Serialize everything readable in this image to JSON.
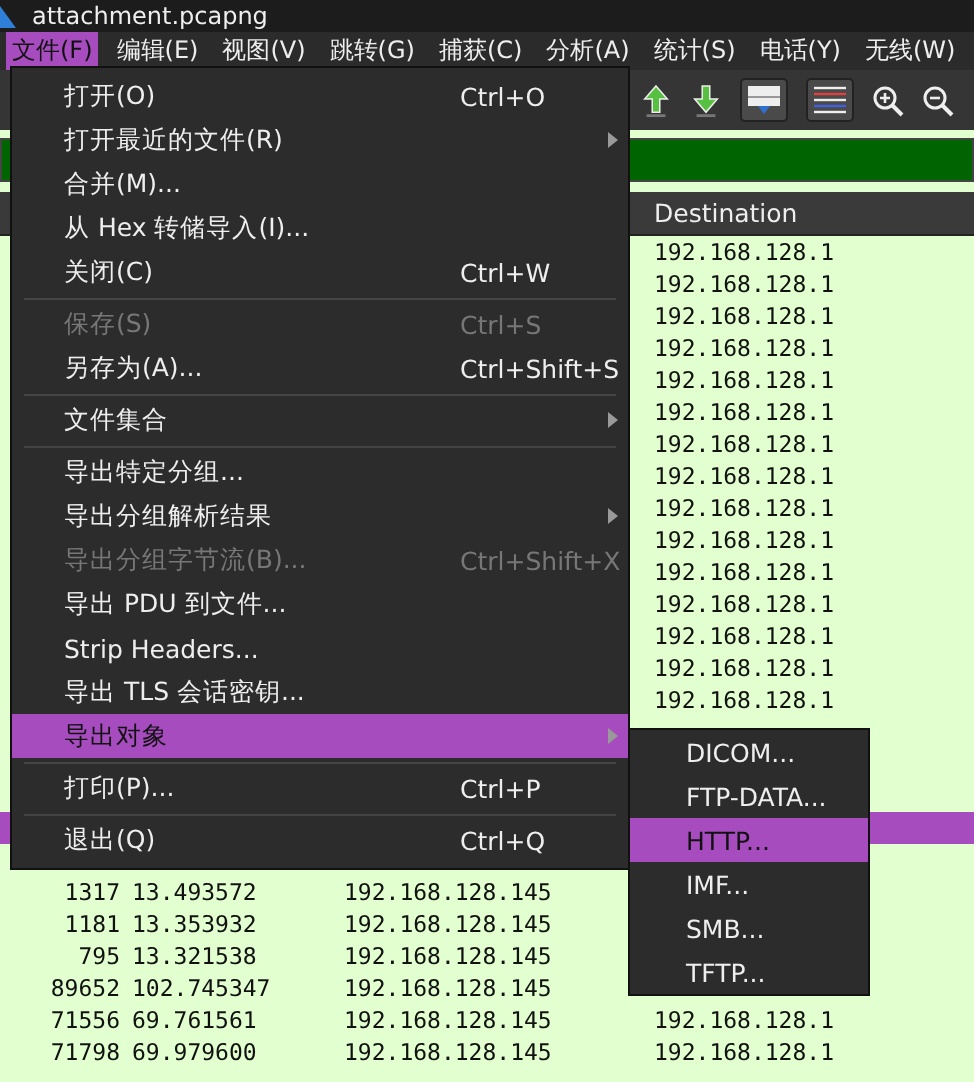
{
  "window": {
    "title": "attachment.pcapng"
  },
  "menubar": [
    {
      "label": "文件(F)",
      "selected": true
    },
    {
      "label": "编辑(E)",
      "selected": false
    },
    {
      "label": "视图(V)",
      "selected": false
    },
    {
      "label": "跳转(G)",
      "selected": false
    },
    {
      "label": "捕获(C)",
      "selected": false
    },
    {
      "label": "分析(A)",
      "selected": false
    },
    {
      "label": "统计(S)",
      "selected": false
    },
    {
      "label": "电话(Y)",
      "selected": false
    },
    {
      "label": "无线(W)",
      "selected": false
    }
  ],
  "packet_list": {
    "columns": [
      {
        "label": "Destination"
      }
    ],
    "rows": [
      {
        "destination": "192.168.128.1",
        "selected": false
      },
      {
        "destination": "192.168.128.1",
        "selected": false
      },
      {
        "destination": "192.168.128.1",
        "selected": false
      },
      {
        "destination": "192.168.128.1",
        "selected": false
      },
      {
        "destination": "192.168.128.1",
        "selected": false
      },
      {
        "destination": "192.168.128.1",
        "selected": false
      },
      {
        "destination": "192.168.128.1",
        "selected": false
      },
      {
        "destination": "192.168.128.1",
        "selected": false
      },
      {
        "destination": "192.168.128.1",
        "selected": false
      },
      {
        "destination": "192.168.128.1",
        "selected": false
      },
      {
        "destination": "192.168.128.1",
        "selected": false
      },
      {
        "destination": "192.168.128.1",
        "selected": false
      },
      {
        "destination": "192.168.128.1",
        "selected": false
      },
      {
        "destination": "192.168.128.1",
        "selected": false
      },
      {
        "destination": "192.168.128.1",
        "selected": false
      },
      {
        "selected": false
      },
      {
        "selected": false
      },
      {
        "selected": false
      },
      {
        "selected": true
      },
      {
        "selected": false
      },
      {
        "no": "1317",
        "time": "13.493572",
        "source": "192.168.128.145",
        "selected": false
      },
      {
        "no": "1181",
        "time": "13.353932",
        "source": "192.168.128.145",
        "selected": false
      },
      {
        "no": "795",
        "time": "13.321538",
        "source": "192.168.128.145",
        "selected": false
      },
      {
        "no": "89652",
        "time": "102.745347",
        "source": "192.168.128.145",
        "selected": false
      },
      {
        "no": "71556",
        "time": "69.761561",
        "source": "192.168.128.145",
        "destination": "192.168.128.1",
        "selected": false
      },
      {
        "no": "71798",
        "time": "69.979600",
        "source": "192.168.128.145",
        "destination": "192.168.128.1",
        "selected": false
      }
    ]
  },
  "file_menu": [
    {
      "kind": "item",
      "label": "打开(O)",
      "shortcut": "Ctrl+O",
      "disabled": false,
      "selected": false
    },
    {
      "kind": "item",
      "label": "打开最近的文件(R)",
      "submenu": true,
      "disabled": false,
      "selected": false
    },
    {
      "kind": "item",
      "label": "合并(M)...",
      "disabled": false,
      "selected": false
    },
    {
      "kind": "item",
      "label": "从 Hex 转储导入(I)...",
      "disabled": false,
      "selected": false
    },
    {
      "kind": "item",
      "label": "关闭(C)",
      "shortcut": "Ctrl+W",
      "disabled": false,
      "selected": false
    },
    {
      "kind": "separator"
    },
    {
      "kind": "item",
      "label": "保存(S)",
      "shortcut": "Ctrl+S",
      "disabled": true,
      "selected": false
    },
    {
      "kind": "item",
      "label": "另存为(A)...",
      "shortcut": "Ctrl+Shift+S",
      "disabled": false,
      "selected": false
    },
    {
      "kind": "separator"
    },
    {
      "kind": "item",
      "label": "文件集合",
      "submenu": true,
      "disabled": false,
      "selected": false
    },
    {
      "kind": "separator"
    },
    {
      "kind": "item",
      "label": "导出特定分组...",
      "disabled": false,
      "selected": false
    },
    {
      "kind": "item",
      "label": "导出分组解析结果",
      "submenu": true,
      "disabled": false,
      "selected": false
    },
    {
      "kind": "item",
      "label": "导出分组字节流(B)...",
      "shortcut": "Ctrl+Shift+X",
      "disabled": true,
      "selected": false
    },
    {
      "kind": "item",
      "label": "导出 PDU 到文件...",
      "disabled": false,
      "selected": false
    },
    {
      "kind": "item",
      "label": "Strip Headers...",
      "disabled": false,
      "selected": false
    },
    {
      "kind": "item",
      "label": "导出 TLS 会话密钥...",
      "disabled": false,
      "selected": false
    },
    {
      "kind": "item",
      "label": "导出对象",
      "submenu": true,
      "disabled": false,
      "selected": true
    },
    {
      "kind": "separator"
    },
    {
      "kind": "item",
      "label": "打印(P)...",
      "shortcut": "Ctrl+P",
      "disabled": false,
      "selected": false
    },
    {
      "kind": "separator"
    },
    {
      "kind": "item",
      "label": "退出(Q)",
      "shortcut": "Ctrl+Q",
      "disabled": false,
      "selected": false
    }
  ],
  "export_objects_submenu": [
    {
      "label": "DICOM...",
      "selected": false
    },
    {
      "label": "FTP-DATA...",
      "selected": false
    },
    {
      "label": "HTTP...",
      "selected": true
    },
    {
      "label": "IMF...",
      "selected": false
    },
    {
      "label": "SMB...",
      "selected": false
    },
    {
      "label": "TFTP...",
      "selected": false
    }
  ]
}
